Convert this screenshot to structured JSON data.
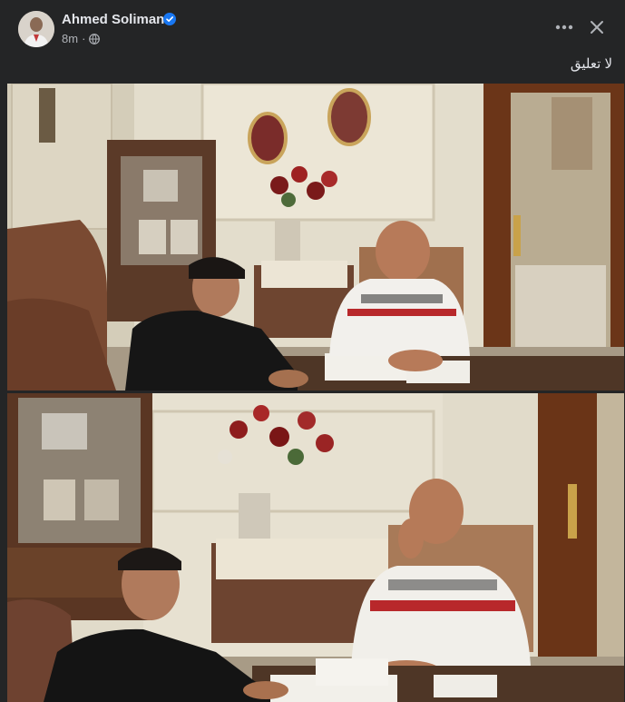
{
  "post": {
    "author": {
      "name": "Ahmed Soliman",
      "verified": true,
      "avatar_icon": "profile-photo"
    },
    "timestamp": "8m",
    "separator": "·",
    "privacy_icon": "globe-icon",
    "text": "لا تعليق",
    "actions": {
      "more_icon": "more-options-icon",
      "close_icon": "close-icon"
    },
    "photos": [
      {
        "icon": "photo-contract-signing-1"
      },
      {
        "icon": "photo-contract-signing-2"
      }
    ]
  },
  "colors": {
    "background": "#242526",
    "primary_text": "#e4e6eb",
    "secondary_text": "#b0b3b8",
    "verified_blue": "#1877f2"
  }
}
